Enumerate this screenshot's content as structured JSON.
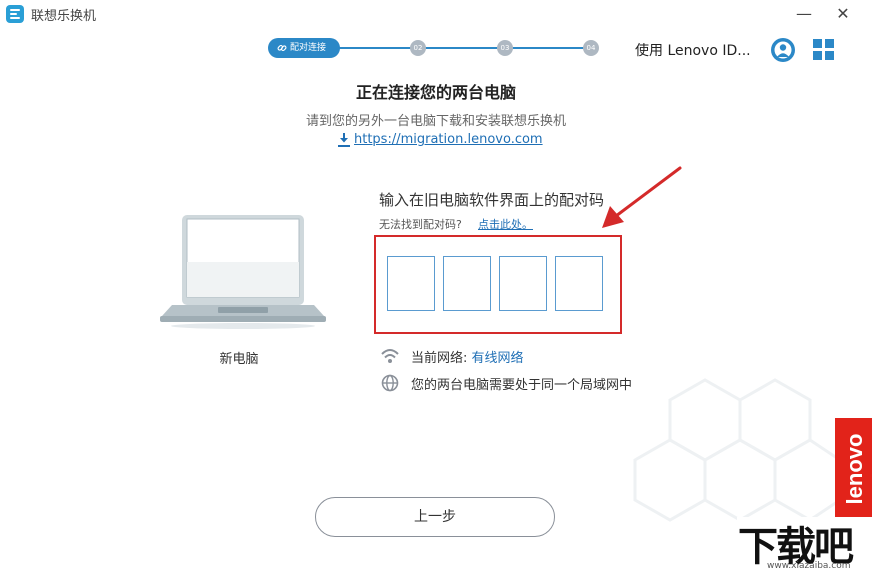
{
  "window": {
    "title": "联想乐换机",
    "minimize_glyph": "—",
    "close_glyph": "✕"
  },
  "stepper": {
    "active_label": "配对连接",
    "steps": [
      "02",
      "03",
      "04"
    ],
    "active_color": "#2b88c7",
    "inactive_color": "#aeb8c2"
  },
  "header": {
    "lenovo_id_label": "使用 Lenovo ID..."
  },
  "main": {
    "title": "正在连接您的两台电脑",
    "subtitle": "请到您的另外一台电脑下载和安装联想乐换机",
    "download_url": "https://migration.lenovo.com"
  },
  "new_pc": {
    "label": "新电脑"
  },
  "pairing": {
    "title": "输入在旧电脑软件界面上的配对码",
    "cant_find": "无法找到配对码?",
    "click_here": "点击此处。",
    "code_values": [
      "",
      "",
      "",
      ""
    ]
  },
  "network": {
    "current_label": "当前网络:",
    "current_value": "有线网络",
    "same_lan_note": "您的两台电脑需要处于同一个局域网中"
  },
  "buttons": {
    "back": "上一步"
  },
  "branding": {
    "lenovo_tab": "lenovo",
    "watermark_logo": "下载吧",
    "watermark_url": "www.xiazaiba.com"
  },
  "colors": {
    "accent": "#2b88c7",
    "link": "#1f6fb5",
    "highlight_red": "#d42a2a",
    "lenovo_red": "#e2231a"
  },
  "icons": [
    "app-icon",
    "link-icon",
    "user-icon",
    "grid-icon",
    "download-icon",
    "laptop-icon",
    "wifi-icon",
    "globe-icon",
    "arrow-annotation"
  ]
}
